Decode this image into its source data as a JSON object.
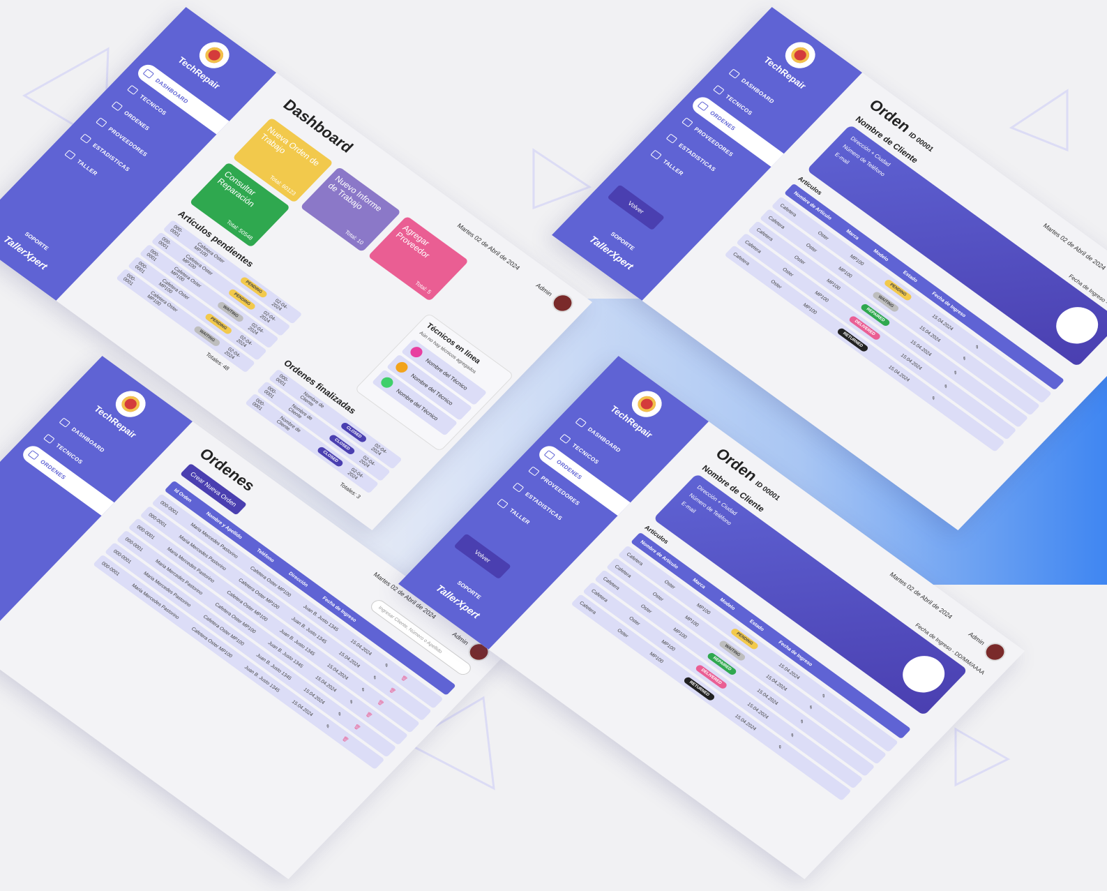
{
  "brand": "TechRepair",
  "brand_bottom": "TallerXpert",
  "support": "SOPORTE",
  "nav": {
    "dashboard": "DASHBOARD",
    "tecnicos": "TECNICOS",
    "ordenes": "ORDENES",
    "proveedores": "PROVEEDORES",
    "estadisticas": "ESTADISTICAS",
    "taller": "TALLER"
  },
  "date": "Martes 02 de Abril de 2024",
  "admin": "Admin",
  "dashboard": {
    "title": "Dashboard",
    "cards": [
      {
        "label": "Nueva Orden de Trabajo",
        "total": "Total: 60123",
        "color": "#f2c94c"
      },
      {
        "label": "Consultar Reparación",
        "total": "Total: 50548",
        "color": "#2fa84f"
      },
      {
        "label": "Nuevo Informe de Trabajo",
        "total": "Total: 10",
        "color": "#8b78c8"
      },
      {
        "label": "Agregar Proveedor",
        "total": "Total: 5",
        "color": "#ea5e93"
      }
    ],
    "pending_title": "Artículos pendientes",
    "pending_rows": [
      {
        "id": "000-0001",
        "item": "Cafetera Oster MP100",
        "status": "PENDING",
        "date": "02-04-2024"
      },
      {
        "id": "000-0001",
        "item": "Cafetera Oster MP100",
        "status": "PENDING",
        "date": "02-04-2024"
      },
      {
        "id": "000-0001",
        "item": "Cafetera Oster MP100",
        "status": "WAITING",
        "date": "02-04-2024"
      },
      {
        "id": "000-0001",
        "item": "Cafetera Oster MP100",
        "status": "PENDING",
        "date": "02-04-2024"
      },
      {
        "id": "000-0001",
        "item": "Cafetera Oster MP100",
        "status": "WAITING",
        "date": "02-04-2024"
      }
    ],
    "pending_total": "Totales: 48",
    "finished_title": "Ordenes finalizadas",
    "finished_rows": [
      {
        "id": "000-0001",
        "client": "Nombre de Cliente",
        "status": "CLOSED",
        "date": "02-04-2024"
      },
      {
        "id": "000-0001",
        "client": "Nombre de Cliente",
        "status": "CLOSED",
        "date": "02-04-2024"
      },
      {
        "id": "000-0001",
        "client": "Nombre de Cliente",
        "status": "CLOSED",
        "date": "02-04-2024"
      }
    ],
    "finished_total": "Totales: 3",
    "tech_title": "Técnicos en línea",
    "tech_empty": "Aún no hay técnicos agregados",
    "tech_rows": [
      "Nombre del Técnico",
      "Nombre del Técnico",
      "Nombre del Técnico"
    ]
  },
  "orders": {
    "title": "Ordenes",
    "create_button": "Crear Nueva Orden",
    "search_placeholder": "Ingresar Cliente, Número o Apellido",
    "columns": [
      "Id Orden",
      "Nombre y Apellido",
      "Teléfono",
      "Dirección",
      "Fecha de Ingreso"
    ],
    "rows": [
      {
        "id": "000-0001",
        "name": "Maria Mercedes Pastorino",
        "item": "Cafetera Oster MP100",
        "address": "Juan B. Justo 1345",
        "date": "15.04.2024"
      },
      {
        "id": "000-0001",
        "name": "Maria Mercedes Pastorino",
        "item": "Cafetera Oster MP100",
        "address": "Juan B. Justo 1345",
        "date": "15.04.2024"
      },
      {
        "id": "000-0001",
        "name": "Maria Mercedes Pastorino",
        "item": "Cafetera Oster MP100",
        "address": "Juan B. Justo 1345",
        "date": "15.04.2024"
      },
      {
        "id": "000-0001",
        "name": "Maria Mercedes Pastorino",
        "item": "Cafetera Oster MP100",
        "address": "Juan B. Justo 1345",
        "date": "15.04.2024"
      },
      {
        "id": "000-0001",
        "name": "Maria Mercedes Pastorino",
        "item": "Cafetera Oster MP100",
        "address": "Juan B. Justo 1345",
        "date": "15.04.2024"
      },
      {
        "id": "000-0001",
        "name": "Maria Mercedes Pastorino",
        "item": "Cafetera Oster MP100",
        "address": "Juan B. Justo 1345",
        "date": "15.04.2024"
      }
    ]
  },
  "order": {
    "title": "Orden",
    "id": "ID 00001",
    "client": "Nombre de Cliente",
    "address": "Dirección + Ciudad",
    "phone": "Número de Teléfono",
    "email": "E-mail",
    "entry_date": "Fecha de Ingreso - DD/MM/AAAA",
    "articles": "Artículos",
    "columns": [
      "Nombre de Artículo",
      "Marca",
      "Modelo",
      "Estado",
      "Fecha de Ingreso"
    ],
    "rows": [
      {
        "name": "Cafetera",
        "brand": "Oster",
        "model": "MP100",
        "status": "PENDING",
        "status_color": "#f2c94c",
        "date": "15.04.2024"
      },
      {
        "name": "Cafetera",
        "brand": "Oster",
        "model": "MP100",
        "status": "WAITING",
        "status_color": "#bdbdbd",
        "date": "15.04.2024"
      },
      {
        "name": "Cafetera",
        "brand": "Oster",
        "model": "MP100",
        "status": "REPAIRED",
        "status_color": "#2fa84f",
        "date": "15.04.2024"
      },
      {
        "name": "Cafetera",
        "brand": "Oster",
        "model": "MP100",
        "status": "DELIVERED",
        "status_color": "#ea5e93",
        "date": "15.04.2024"
      },
      {
        "name": "Cafetera",
        "brand": "Oster",
        "model": "MP100",
        "status": "RETURNED",
        "status_color": "#222222",
        "date": "15.04.2024"
      }
    ],
    "back_button": "Volver"
  },
  "colors": {
    "primary": "#5f63d4",
    "dark": "#4a3fb0",
    "row": "#dcddf7"
  }
}
